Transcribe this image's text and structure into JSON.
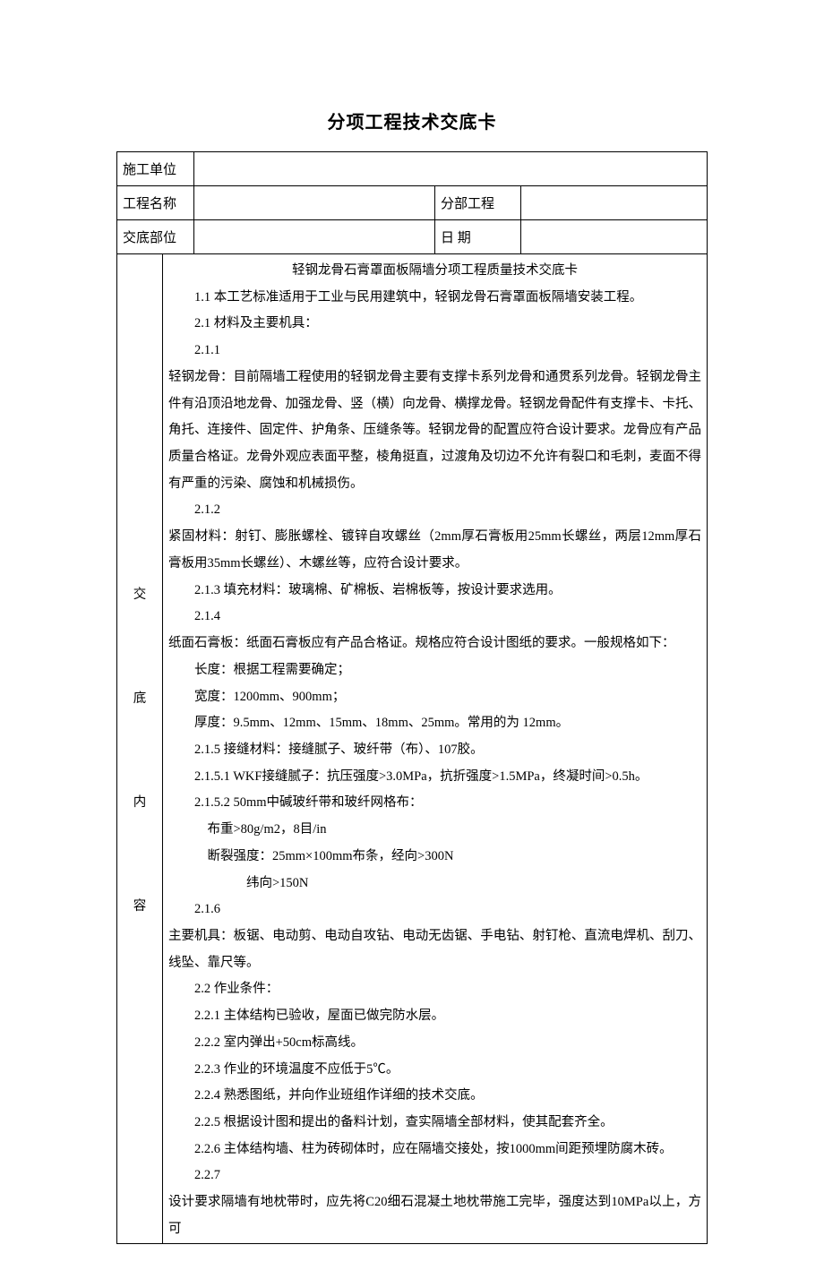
{
  "title": "分项工程技术交底卡",
  "header": {
    "row1_label": "施工单位",
    "row1_val": "",
    "row2_label": "工程名称",
    "row2_val": "",
    "row2_label2": "分部工程",
    "row2_val2": "",
    "row3_label": "交底部位",
    "row3_val": "",
    "row3_label2": "日 期",
    "row3_val2": ""
  },
  "side_label": "交\n\n底\n\n内\n\n容",
  "body": {
    "p0": "轻钢龙骨石膏罩面板隔墙分项工程质量技术交底卡",
    "p1": "1.1 本工艺标准适用于工业与民用建筑中，轻钢龙骨石膏罩面板隔墙安装工程。",
    "p2": "2.1 材料及主要机具：",
    "p3": "2.1.1",
    "p4": "轻钢龙骨：目前隔墙工程使用的轻钢龙骨主要有支撑卡系列龙骨和通贯系列龙骨。轻钢龙骨主件有沿顶沿地龙骨、加强龙骨、竖（横）向龙骨、横撑龙骨。轻钢龙骨配件有支撑卡、卡托、角托、连接件、固定件、护角条、压缝条等。轻钢龙骨的配置应符合设计要求。龙骨应有产品质量合格证。龙骨外观应表面平整，棱角挺直，过渡角及切边不允许有裂口和毛刺，麦面不得有严重的污染、腐蚀和机械损伤。",
    "p5": "2.1.2",
    "p6": "紧固材料：射钉、膨胀螺栓、镀锌自攻螺丝（2mm厚石膏板用25mm长螺丝，两层12mm厚石膏板用35mm长螺丝）、木螺丝等，应符合设计要求。",
    "p7": "2.1.3 填充材料：玻璃棉、矿棉板、岩棉板等，按设计要求选用。",
    "p8": "2.1.4",
    "p9": "纸面石膏板：纸面石膏板应有产品合格证。规格应符合设计图纸的要求。一般规格如下：",
    "p10": "长度：根据工程需要确定；",
    "p11": "宽度：1200mm、900mm；",
    "p12": "厚度：9.5mm、12mm、15mm、18mm、25mm。常用的为 12mm。",
    "p13": "2.1.5 接缝材料：接缝腻子、玻纤带（布）、107胶。",
    "p14": "2.1.5.1  WKF接缝腻子：抗压强度>3.0MPa，抗折强度>1.5MPa，终凝时间>0.5h。",
    "p15": "2.1.5.2  50mm中碱玻纤带和玻纤网格布：",
    "p16": "布重>80g/m2，8目/in",
    "p17": "断裂强度：25mm×100mm布条，经向>300N",
    "p18": "纬向>150N",
    "p19": "2.1.6",
    "p20": "主要机具：板锯、电动剪、电动自攻钻、电动无齿锯、手电钻、射钉枪、直流电焊机、刮刀、线坠、靠尺等。",
    "p21": "2.2 作业条件：",
    "p22": "2.2.1 主体结构已验收，屋面已做完防水层。",
    "p23": "2.2.2 室内弹出+50cm标高线。",
    "p24": "2.2.3 作业的环境温度不应低于5℃。",
    "p25": "2.2.4 熟悉图纸，并向作业班组作详细的技术交底。",
    "p26": "2.2.5 根据设计图和提出的备料计划，查实隔墙全部材料，使其配套齐全。",
    "p27": "2.2.6 主体结构墙、柱为砖砌体时，应在隔墙交接处，按1000mm间距预埋防腐木砖。",
    "p28": "2.2.7",
    "p29": "设计要求隔墙有地枕带时，应先将C20细石混凝土地枕带施工完毕，强度达到10MPa以上，方可"
  }
}
